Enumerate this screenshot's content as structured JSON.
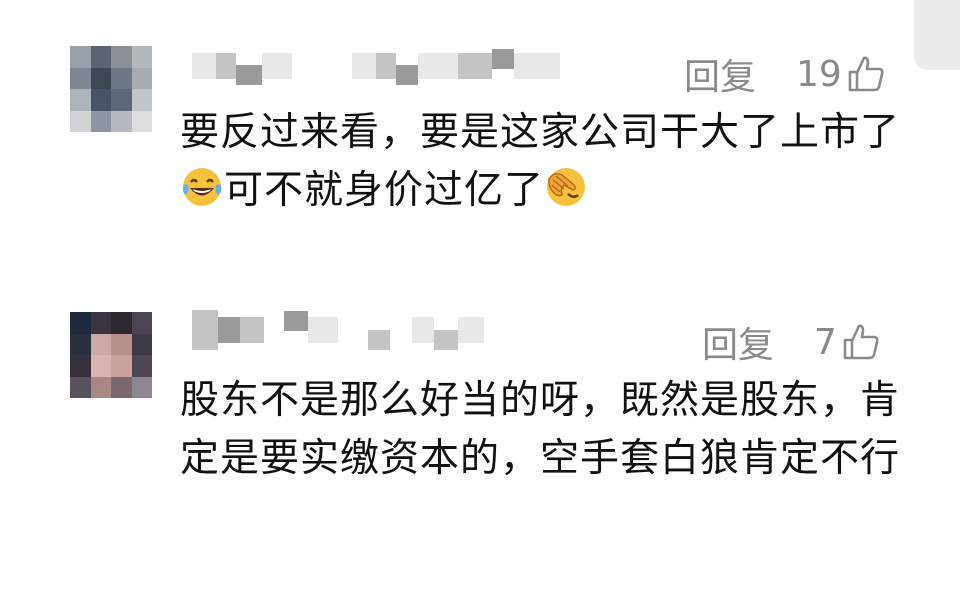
{
  "comments": [
    {
      "reply_label": "回复",
      "like_count": "19",
      "text_part1": "要反过来看，要是这家公司干大了上市了",
      "text_part2": "可不就身价过亿了",
      "emoji1": "laughing-tears-emoji",
      "emoji2": "facepalm-emoji"
    },
    {
      "reply_label": "回复",
      "like_count": "7",
      "text": "股东不是那么好当的呀，既然是股东，肯定是要实缴资本的，空手套白狼肯定不行"
    }
  ],
  "icons": {
    "like": "thumbs-up-icon"
  },
  "colors": {
    "action_gray": "#8a8a8a",
    "text": "#111111"
  }
}
